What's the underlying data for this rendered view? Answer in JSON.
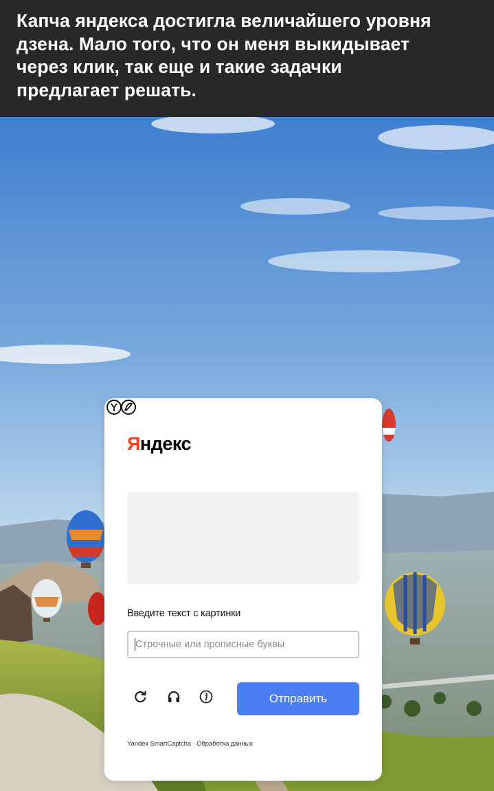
{
  "post": {
    "caption_lines": [
      "Капча яндекса достигла величайшего уровня",
      "дзена. Мало того, что он меня выкидывает",
      "через клик, так еще и такие задачки",
      "предлагает решать."
    ]
  },
  "captcha": {
    "logo_first_letter": "Я",
    "logo_rest": "ндекс",
    "prompt_label": "Введите текст с картинки",
    "input_placeholder": "Строчные или прописные буквы",
    "input_value": "",
    "submit_label": "Отправить",
    "footer_text": "Yandex SmartCaptcha · Обработка данных",
    "icons": [
      "refresh-icon",
      "headphones-icon",
      "info-icon"
    ],
    "colors": {
      "brand_red": "#fc3f1d",
      "submit_blue": "#4c7ef3",
      "image_placeholder": "#f2f2f2"
    }
  }
}
